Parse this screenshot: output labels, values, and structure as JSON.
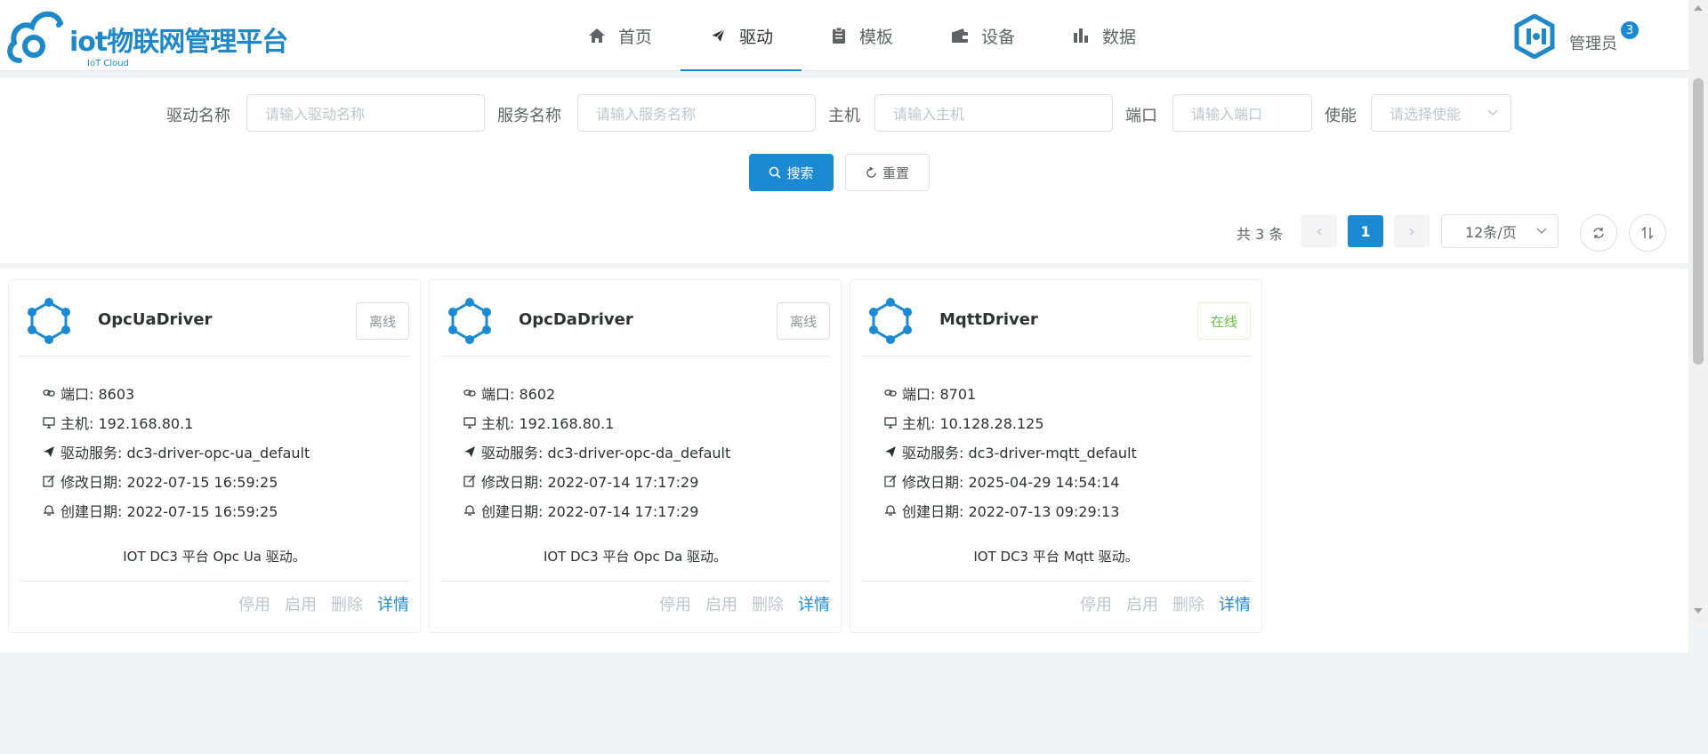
{
  "brand": {
    "title": "iot物联网管理平台",
    "subtitle": "IoT Cloud",
    "color": "#1e88c9"
  },
  "nav": {
    "items": [
      {
        "label": "首页",
        "icon": "home-icon"
      },
      {
        "label": "驱动",
        "icon": "send-icon",
        "active": true
      },
      {
        "label": "模板",
        "icon": "clipboard-icon"
      },
      {
        "label": "设备",
        "icon": "wallet-icon"
      },
      {
        "label": "数据",
        "icon": "bar-chart-icon"
      }
    ]
  },
  "user": {
    "name": "管理员",
    "badge": "3"
  },
  "search": {
    "fields": [
      {
        "label": "驱动名称",
        "placeholder": "请输入驱动名称"
      },
      {
        "label": "服务名称",
        "placeholder": "请输入服务名称"
      },
      {
        "label": "主机",
        "placeholder": "请输入主机"
      },
      {
        "label": "端口",
        "placeholder": "请输入端口"
      },
      {
        "label": "使能",
        "placeholder": "请选择使能"
      }
    ],
    "search_label": "搜索",
    "reset_label": "重置"
  },
  "pagination": {
    "total": "共 3 条",
    "prev": "‹",
    "current": "1",
    "next": "›",
    "page_size": "12条/页"
  },
  "cards": [
    {
      "title": "OpcUaDriver",
      "status": "离线",
      "online": false,
      "port": "端口: 8603",
      "host": "主机: 192.168.80.1",
      "service": "驱动服务: dc3-driver-opc-ua_default",
      "updated": "修改日期: 2022-07-15 16:59:25",
      "created": "创建日期: 2022-07-15 16:59:25",
      "description": "IOT DC3 平台 Opc Ua 驱动。",
      "actions": {
        "disable": "停用",
        "enable": "启用",
        "delete": "删除",
        "detail": "详情"
      }
    },
    {
      "title": "OpcDaDriver",
      "status": "离线",
      "online": false,
      "port": "端口: 8602",
      "host": "主机: 192.168.80.1",
      "service": "驱动服务: dc3-driver-opc-da_default",
      "updated": "修改日期: 2022-07-14 17:17:29",
      "created": "创建日期: 2022-07-14 17:17:29",
      "description": "IOT DC3 平台 Opc Da 驱动。",
      "actions": {
        "disable": "停用",
        "enable": "启用",
        "delete": "删除",
        "detail": "详情"
      }
    },
    {
      "title": "MqttDriver",
      "status": "在线",
      "online": true,
      "port": "端口: 8701",
      "host": "主机: 10.128.28.125",
      "service": "驱动服务: dc3-driver-mqtt_default",
      "updated": "修改日期: 2025-04-29 14:54:14",
      "created": "创建日期: 2022-07-13 09:29:13",
      "description": "IOT DC3 平台 Mqtt 驱动。",
      "actions": {
        "disable": "停用",
        "enable": "启用",
        "delete": "删除",
        "detail": "详情"
      }
    }
  ],
  "colors": {
    "primary": "#1c8ad3",
    "online": "#67c23a",
    "offline": "#909399",
    "disabled_action": "#c0c4cc"
  }
}
